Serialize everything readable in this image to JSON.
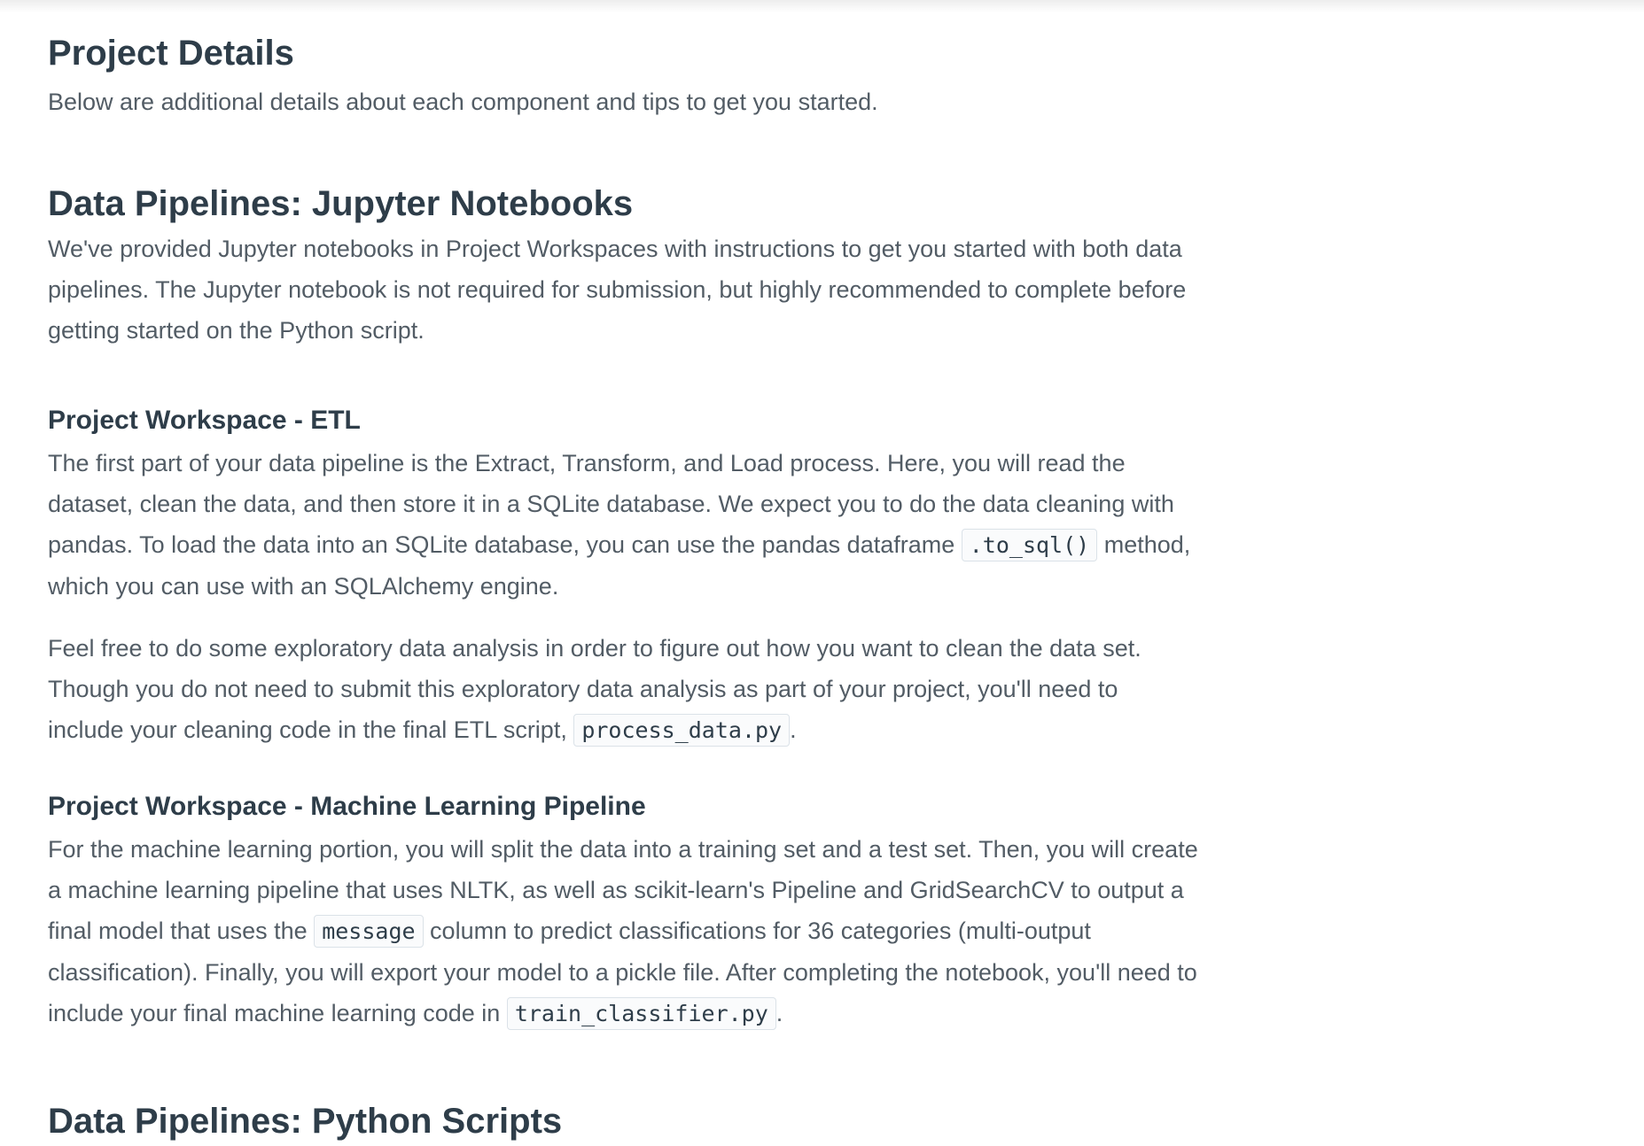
{
  "project_details": {
    "title": "Project Details",
    "intro": "Below are additional details about each component and tips to get you started."
  },
  "jupyter_section": {
    "title": "Data Pipelines: Jupyter Notebooks",
    "intro": "We've provided Jupyter notebooks in Project Workspaces with instructions to get you started with both data pipelines. The Jupyter notebook is not required for submission, but highly recommended to complete before getting started on the Python script."
  },
  "etl_section": {
    "title": "Project Workspace - ETL",
    "p1_before": "The first part of your data pipeline is the Extract, Transform, and Load process. Here, you will read the dataset, clean the data, and then store it in a SQLite database. We expect you to do the data cleaning with pandas. To load the data into an SQLite database, you can use the pandas dataframe ",
    "p1_code": ".to_sql()",
    "p1_after": " method, which you can use with an SQLAlchemy engine.",
    "p2_before": "Feel free to do some exploratory data analysis in order to figure out how you want to clean the data set. Though you do not need to submit this exploratory data analysis as part of your project, you'll need to include your cleaning code in the final ETL script, ",
    "p2_code": "process_data.py",
    "p2_after": "."
  },
  "ml_section": {
    "title": "Project Workspace - Machine Learning Pipeline",
    "p_before": "For the machine learning portion, you will split the data into a training set and a test set. Then, you will create a machine learning pipeline that uses NLTK, as well as scikit-learn's Pipeline and GridSearchCV to output a final model that uses the ",
    "p_code1": "message",
    "p_middle": " column to predict classifications for 36 categories (multi-output classification). Finally, you will export your model to a pickle file. After completing the notebook, you'll need to include your final machine learning code in ",
    "p_code2": "train_classifier.py",
    "p_after": "."
  },
  "scripts_section": {
    "title": "Data Pipelines: Python Scripts"
  }
}
